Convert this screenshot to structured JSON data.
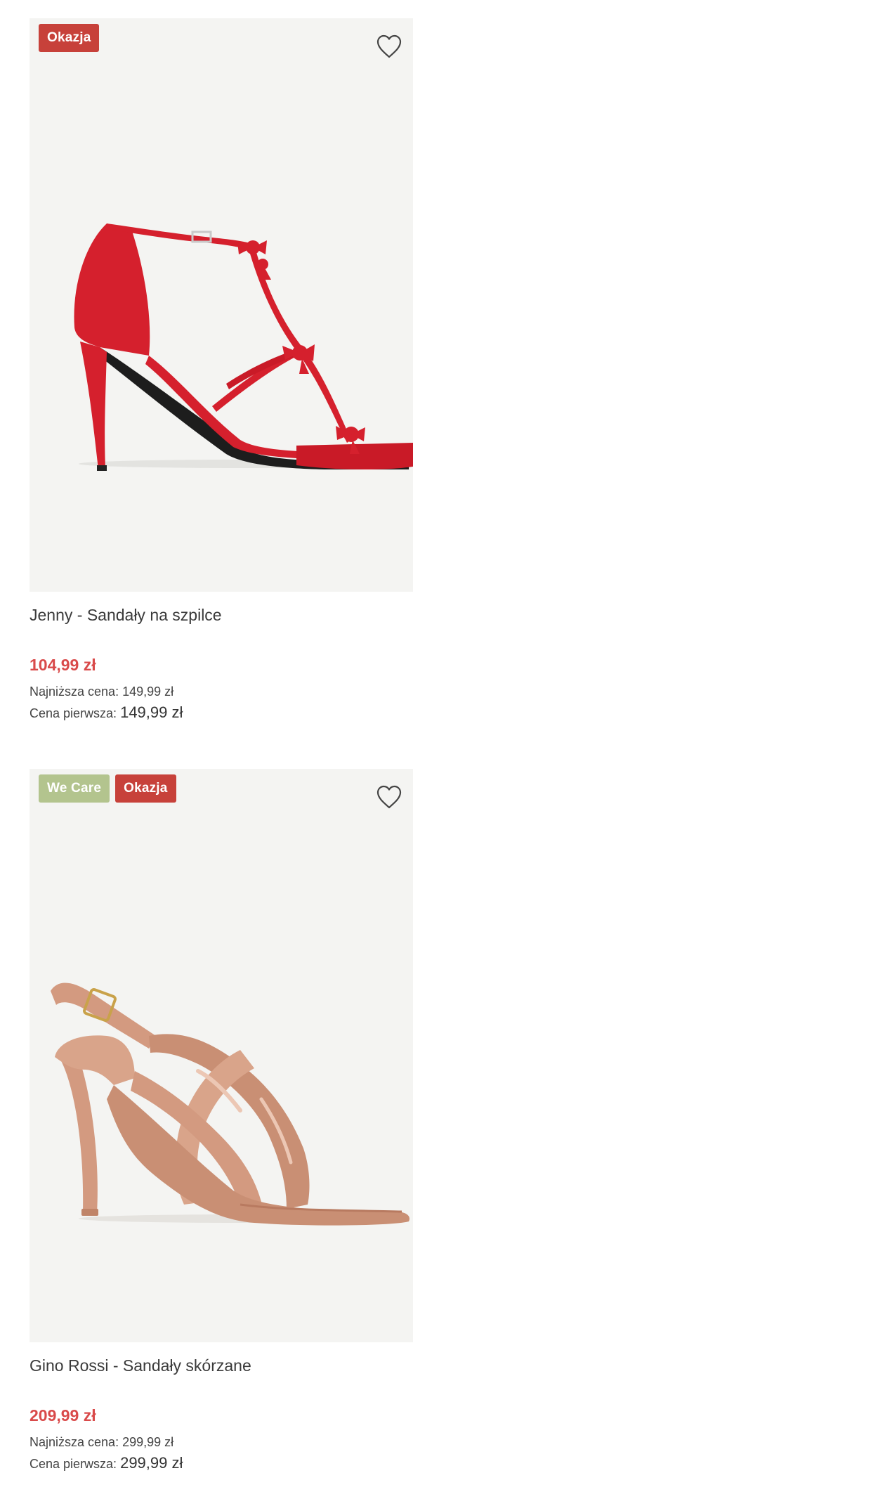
{
  "products": [
    {
      "badges": [
        "Okazja"
      ],
      "name": "Jenny - Sandały na szpilce",
      "price": "104,99 zł",
      "lowest_label": "Najniższa cena:",
      "lowest_value": "149,99 zł",
      "original_label": "Cena pierwsza:",
      "original_value": "149,99 zł",
      "shoe_color": "#d5202d"
    },
    {
      "badges": [
        "We Care",
        "Okazja"
      ],
      "name": "Gino Rossi - Sandały skórzane",
      "price": "209,99 zł",
      "lowest_label": "Najniższa cena:",
      "lowest_value": "299,99 zł",
      "original_label": "Cena pierwsza:",
      "original_value": "299,99 zł",
      "shoe_color": "#d39a80"
    }
  ],
  "icons": {
    "wishlist": "heart-outline-icon"
  },
  "colors": {
    "sale_badge": "#c7413a",
    "wecare_badge": "#b3c48e",
    "sale_price": "#d94a4a",
    "image_bg": "#f4f4f2"
  }
}
